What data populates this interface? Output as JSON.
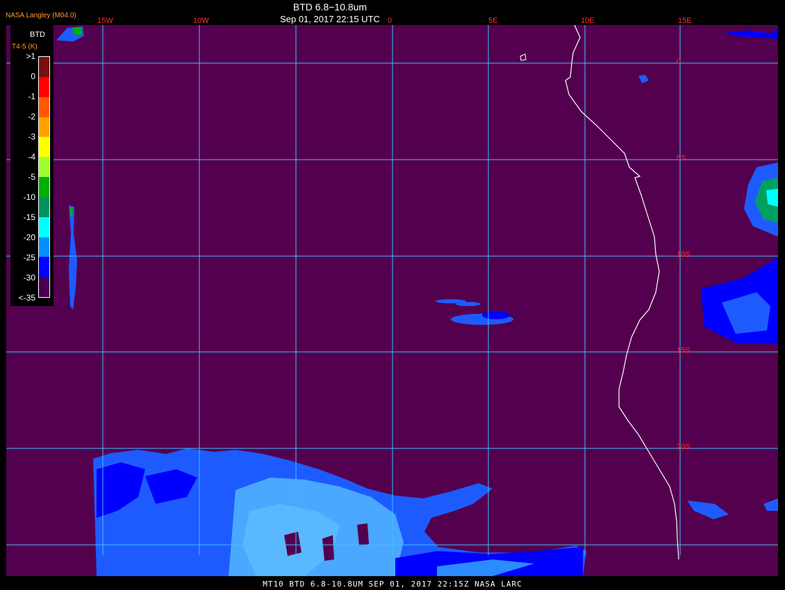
{
  "title": "BTD 6.8−10.8um",
  "subtitle": "Sep 01, 2017 22:15 UTC",
  "agency": "NASA Langley (M04.0)",
  "footer": "MT10  BTD 6.8-10.8UM  SEP 01, 2017 22:15Z  NASA LARC",
  "legend": {
    "title": "BTD",
    "unit": "T4-5 (K)",
    "labels": [
      ">1",
      "0",
      "-1",
      "-2",
      "-3",
      "-4",
      "-5",
      "-10",
      "-15",
      "-20",
      "-25",
      "-30",
      "<-35"
    ],
    "colors": [
      "#7a0f0f",
      "#ff0000",
      "#ff5a00",
      "#ffa000",
      "#ffff00",
      "#a0ff30",
      "#00b000",
      "#009060",
      "#00ffff",
      "#0090ff",
      "#0000ff",
      "#4a0050"
    ]
  },
  "grid": {
    "lon_labels": [
      "15W",
      "10W",
      "0",
      "5E",
      "10E",
      "15E"
    ],
    "lat_labels": [
      "0",
      "5S",
      "10S",
      "15S",
      "20S"
    ]
  },
  "colors": {
    "background": "#53004f",
    "grid": "#40c0ff",
    "coast": "#ffffff",
    "cloud_dark": "#0000ff",
    "cloud_mid": "#1e5bff",
    "cloud_light": "#4aa8ff",
    "label": "#ff3030"
  }
}
